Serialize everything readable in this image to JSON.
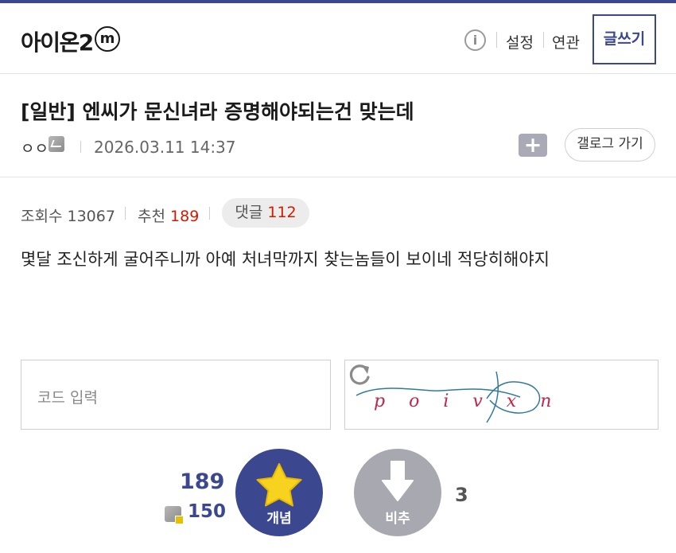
{
  "header": {
    "logo_text": "아이온2",
    "logo_badge": "m",
    "info_icon_glyph": "i",
    "settings_label": "설정",
    "related_label": "연관",
    "write_label": "글쓰기"
  },
  "post": {
    "title": "[일반] 엔씨가 문신녀라 증명해야되는건 맞는데",
    "author": "ㅇㅇ",
    "date": "2026.03.11 14:37",
    "folder_glyph": "+",
    "gallery_button": "갤로그 가기",
    "views_label": "조회수",
    "views_value": "13067",
    "recommend_label": "추천",
    "recommend_value": "189",
    "comments_label": "댓글",
    "comments_value": "112",
    "body": "몇달 조신하게 굴어주니까 아예 처녀막까지 찾는놈들이 보이네 적당히해야지"
  },
  "captcha": {
    "placeholder": "코드 입력",
    "text": "poivxn"
  },
  "vote": {
    "recommend_count": "189",
    "fixed_count": "150",
    "up_label": "개념",
    "down_label": "비추",
    "down_count": "3"
  },
  "colors": {
    "accent": "#3b4890",
    "highlight": "#d31900",
    "down_button": "#a8a8b0"
  }
}
